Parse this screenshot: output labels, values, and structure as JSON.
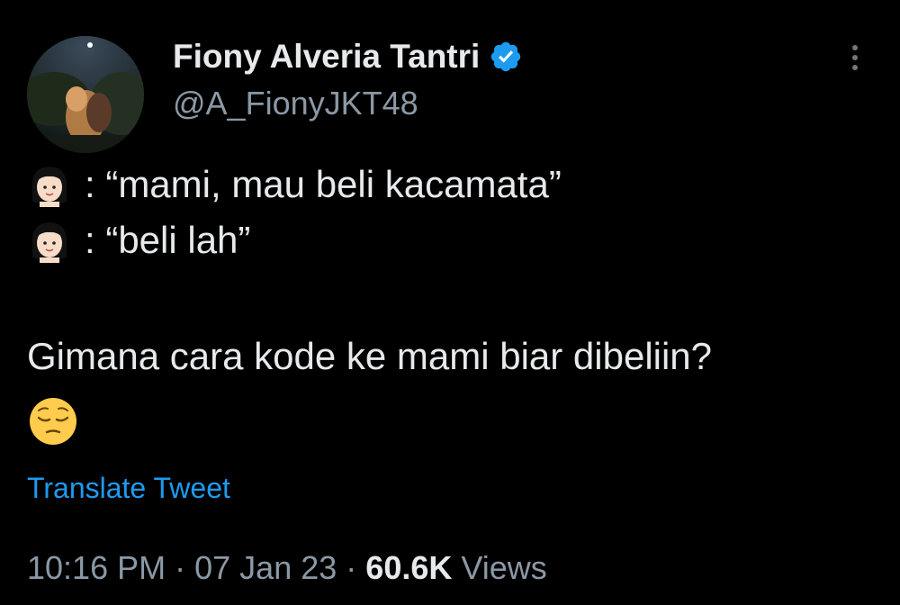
{
  "user": {
    "display_name": "Fiony Alveria Tantri",
    "handle": "@A_FionyJKT48",
    "verified": true
  },
  "tweet": {
    "lines": [
      {
        "speaker_icon": "woman-emoji-icon",
        "text": ": “mami, mau beli kacamata”"
      },
      {
        "speaker_icon": "woman-emoji-icon",
        "text": ": “beli lah”"
      }
    ],
    "body": "Gimana cara kode ke mami biar dibeliin?",
    "trailing_emoji": "pensive-face-emoji-icon",
    "translate_label": "Translate Tweet",
    "time": "10:16 PM",
    "separator": "·",
    "date": "07 Jan 23",
    "views_count": "60.6K",
    "views_label": "Views"
  },
  "colors": {
    "background": "#000000",
    "primary_text": "#e7e9ea",
    "secondary_text": "#8b98a5",
    "link": "#1d9bf0",
    "verified_badge": "#1d9bf0"
  }
}
